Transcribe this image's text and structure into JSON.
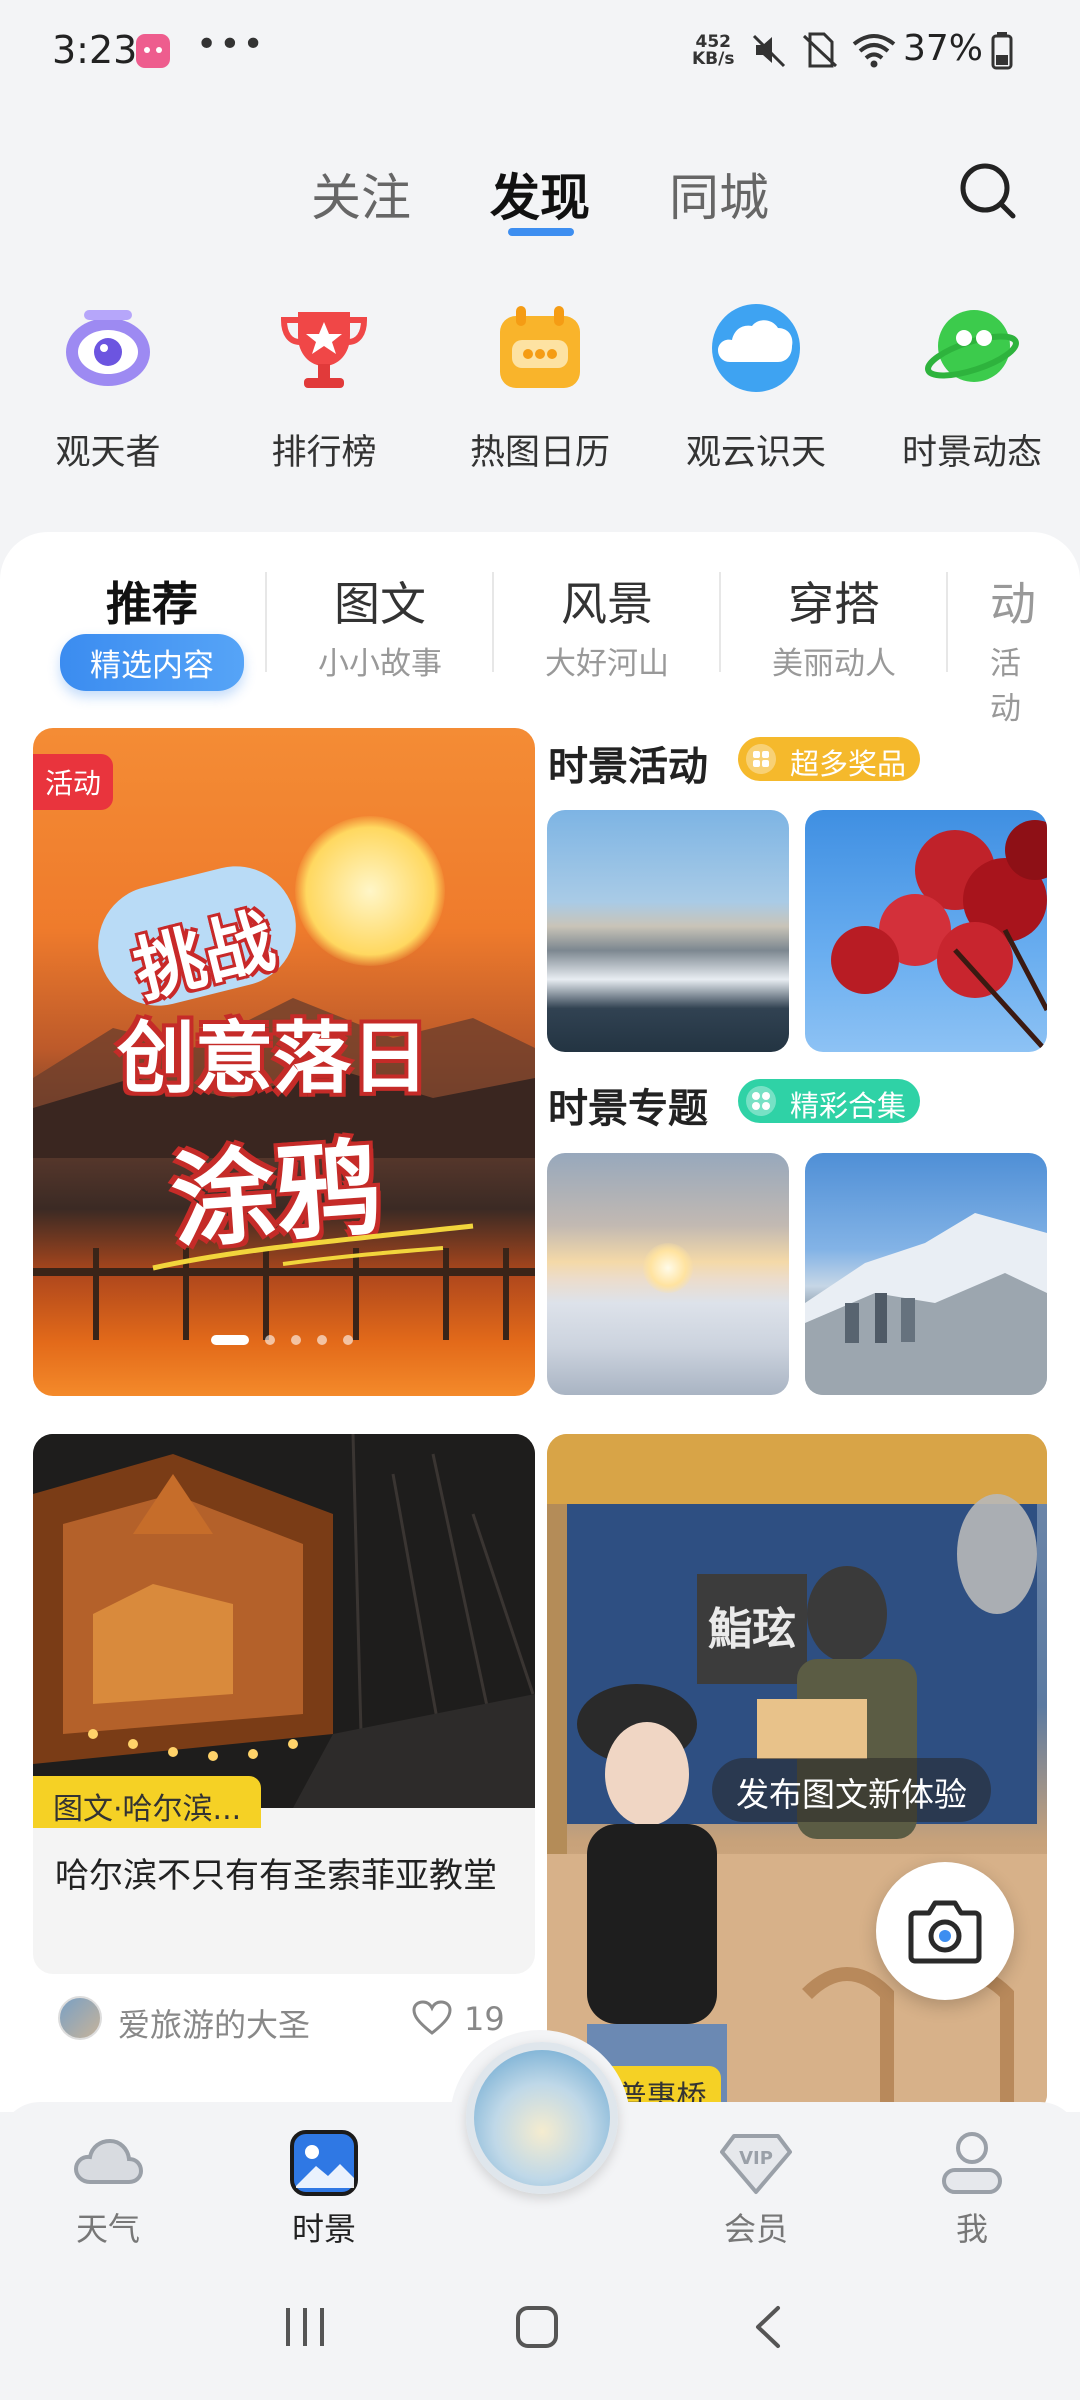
{
  "status_bar": {
    "time": "3:23",
    "speed_value": "452",
    "speed_unit": "KB/s",
    "battery": "37%",
    "icons": [
      "app-notification-icon",
      "more-dots-icon",
      "mute-icon",
      "no-sim-icon",
      "wifi-icon",
      "battery-icon"
    ]
  },
  "top_tabs": [
    {
      "label": "关注"
    },
    {
      "label": "发现"
    },
    {
      "label": "同城"
    }
  ],
  "quick_links": [
    {
      "label": "观天者",
      "icon": "eye-icon"
    },
    {
      "label": "排行榜",
      "icon": "trophy-icon"
    },
    {
      "label": "热图日历",
      "icon": "calendar-icon"
    },
    {
      "label": "观云识天",
      "icon": "cloud-icon"
    },
    {
      "label": "时景动态",
      "icon": "planet-icon"
    }
  ],
  "categories": [
    {
      "title": "推荐",
      "sub": "精选内容"
    },
    {
      "title": "图文",
      "sub": "小小故事"
    },
    {
      "title": "风景",
      "sub": "大好河山"
    },
    {
      "title": "穿搭",
      "sub": "美丽动人"
    },
    {
      "title": "动",
      "sub": "活动"
    }
  ],
  "banner": {
    "tag": "活动",
    "line1": "挑战",
    "line2": "创意落日",
    "line3": "涂鸦",
    "slide_count": 5,
    "active_slide": 1
  },
  "sections": {
    "activity": {
      "title": "时景活动",
      "badge": "超多奖品",
      "badge_color": "#f5b92c"
    },
    "topic": {
      "title": "时景专题",
      "badge": "精彩合集",
      "badge_color": "#2fd2a6"
    }
  },
  "feed": {
    "left": {
      "tag": "图文·哈尔滨...",
      "title": "哈尔滨不只有有圣索菲亚教堂",
      "author": "爱旅游的大圣",
      "likes": "19"
    },
    "right": {
      "tag": "文·普惠桥",
      "sign": "鮨玹"
    }
  },
  "publish_tip": "发布图文新体验",
  "bottom_nav": [
    {
      "label": "天气",
      "icon": "cloud-outline-icon"
    },
    {
      "label": "时景",
      "icon": "photo-icon"
    },
    {
      "label": "会员",
      "icon": "vip-icon"
    },
    {
      "label": "我",
      "icon": "person-icon"
    }
  ],
  "colors": {
    "accent": "#3d8ef0",
    "tag_yellow": "#f5d125",
    "activity_red": "#e9343d"
  }
}
